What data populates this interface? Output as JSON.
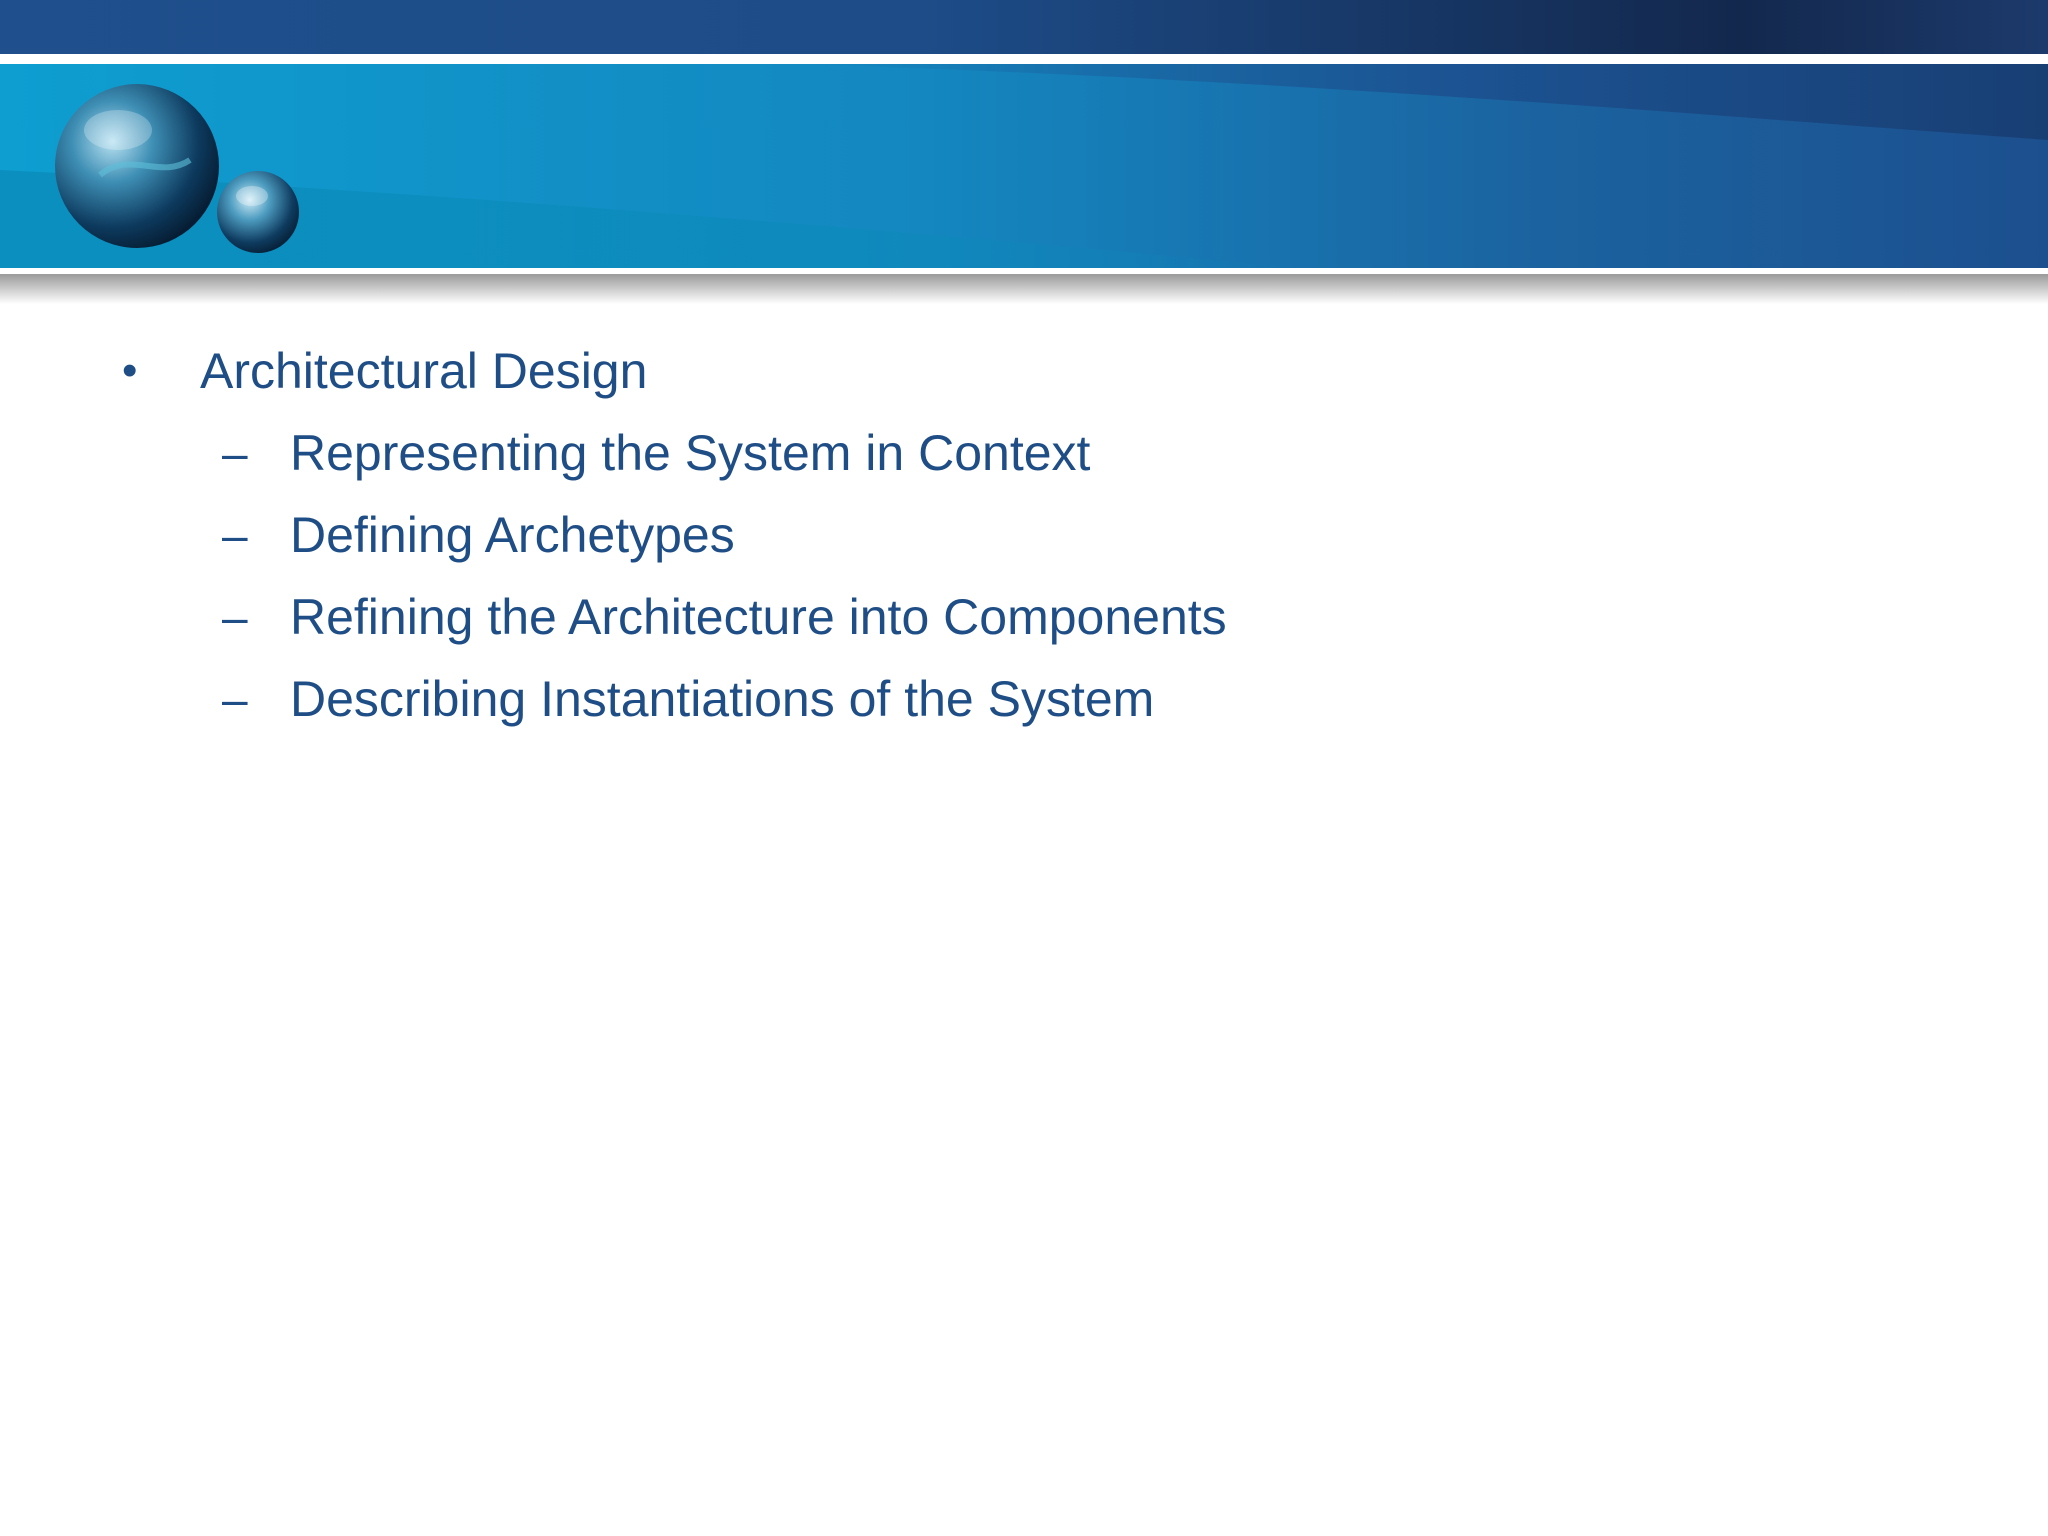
{
  "colors": {
    "text": "#1f4e86",
    "banner_light": "#0fa0cc",
    "banner_dark": "#1c4f8f",
    "top_bar": "#1a3f74"
  },
  "icons": {
    "decoration": "spheres-icon"
  },
  "bullets": [
    {
      "marker": "•",
      "label": "Architectural Design",
      "subitems": [
        {
          "marker": "–",
          "label": "Representing the System in Context"
        },
        {
          "marker": "–",
          "label": "Defining Archetypes"
        },
        {
          "marker": "–",
          "label": "Refining the Architecture into Components"
        },
        {
          "marker": "–",
          "label": "Describing Instantiations of the System"
        }
      ]
    }
  ]
}
